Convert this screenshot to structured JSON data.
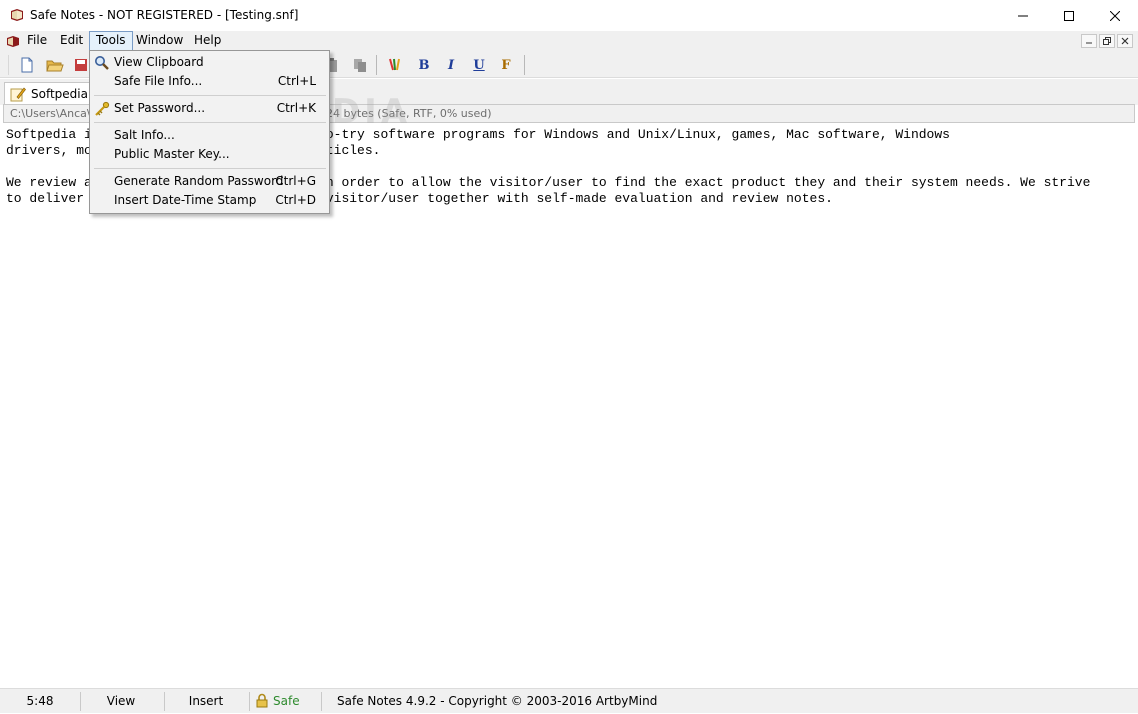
{
  "window": {
    "title": "Safe Notes - NOT REGISTERED - [Testing.snf]",
    "controls": {
      "minimize": "minimize",
      "maximize": "maximize",
      "close": "close"
    }
  },
  "menubar": {
    "items": [
      {
        "label": "File"
      },
      {
        "label": "Edit"
      },
      {
        "label": "Tools"
      },
      {
        "label": "Window"
      },
      {
        "label": "Help"
      }
    ]
  },
  "toolbar": {
    "buttons": [
      "new-document-icon",
      "open-folder-icon",
      "save-icon",
      "paste-icon",
      "copy-icon",
      "color-pencils-icon"
    ],
    "format": {
      "bold": "B",
      "italic": "I",
      "underline": "U",
      "font": "F"
    }
  },
  "tab": {
    "label": "Softpedia.snf"
  },
  "pathbar": {
    "path": "C:\\Users\\Anca\\",
    "info": "24 bytes (Safe, RTF, 0% used)"
  },
  "editor": {
    "text": "Softpedia is a library of free and free-to-try software programs for Windows and Unix/Linux, games, Mac software, Windows\ndrivers, mobile devices and IT-related articles.\n\nWe review and categorize these products in order to allow the visitor/user to find the exact product they and their system needs. We strive\nto deliver only the best products to the visitor/user together with self-made evaluation and review notes."
  },
  "tools_menu": {
    "items": [
      {
        "label": "View Clipboard",
        "shortcut": "",
        "icon": "magnifier-icon"
      },
      {
        "label": "Safe File Info...",
        "shortcut": "Ctrl+L",
        "icon": ""
      },
      {
        "label": "Set Password...",
        "shortcut": "Ctrl+K",
        "icon": "key-icon"
      },
      {
        "label": "Salt Info...",
        "shortcut": "",
        "icon": ""
      },
      {
        "label": "Public Master Key...",
        "shortcut": "",
        "icon": ""
      },
      {
        "label": "Generate Random Password",
        "shortcut": "Ctrl+G",
        "icon": ""
      },
      {
        "label": "Insert Date-Time Stamp",
        "shortcut": "Ctrl+D",
        "icon": ""
      }
    ]
  },
  "watermark": "SOFTPEDIA",
  "statusbar": {
    "time": "5:48",
    "view": "View",
    "mode": "Insert",
    "safe": "Safe",
    "about": "Safe Notes 4.9.2  -  Copyright © 2003-2016 ArtbyMind"
  },
  "colors": {
    "menu_highlight": "#e5f1fb",
    "safe_text": "#2e8b2e"
  }
}
